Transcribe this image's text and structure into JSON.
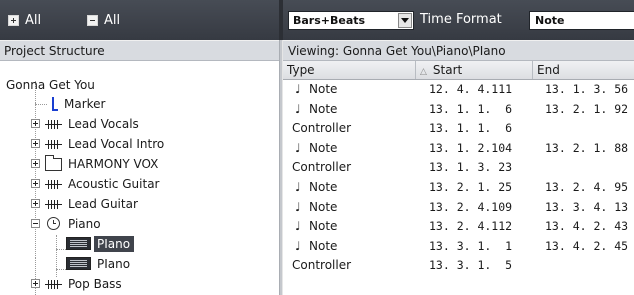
{
  "toolbar": {
    "expand_all_label": "All",
    "collapse_all_label": "All",
    "display_format": "Bars+Beats",
    "time_format_label": "Time Format",
    "event_type": "Note"
  },
  "project_structure": {
    "header": "Project Structure",
    "root": "Gonna Get You",
    "items": [
      {
        "label": "Marker",
        "icon": "marker-icon"
      },
      {
        "label": "Lead Vocals",
        "icon": "audio-track-icon"
      },
      {
        "label": "Lead Vocal Intro",
        "icon": "audio-track-icon"
      },
      {
        "label": "HARMONY VOX",
        "icon": "folder-icon"
      },
      {
        "label": "Acoustic Guitar",
        "icon": "audio-track-icon"
      },
      {
        "label": "Lead Guitar",
        "icon": "audio-track-icon"
      },
      {
        "label": "Piano",
        "icon": "midi-track-icon"
      },
      {
        "label": "PIano",
        "icon": "midi-part-icon"
      },
      {
        "label": "PIano",
        "icon": "midi-part-icon"
      },
      {
        "label": "Pop Bass",
        "icon": "audio-track-icon"
      }
    ]
  },
  "event_list": {
    "viewing_label": "Viewing: Gonna Get You\\Piano\\PIano",
    "columns": {
      "type": "Type",
      "start": "Start",
      "end": "End"
    },
    "rows": [
      {
        "type": "Note",
        "start": "12. 4. 4.111",
        "end": "13. 1. 3. 56"
      },
      {
        "type": "Note",
        "start": "13. 1. 1.  6",
        "end": "13. 2. 1. 92"
      },
      {
        "type": "Controller",
        "start": "13. 1. 1.  6",
        "end": ""
      },
      {
        "type": "Note",
        "start": "13. 1. 2.104",
        "end": "13. 2. 1. 88"
      },
      {
        "type": "Controller",
        "start": "13. 1. 3. 23",
        "end": ""
      },
      {
        "type": "Note",
        "start": "13. 2. 1. 25",
        "end": "13. 2. 4. 95"
      },
      {
        "type": "Note",
        "start": "13. 2. 4.109",
        "end": "13. 3. 4. 13"
      },
      {
        "type": "Note",
        "start": "13. 2. 4.112",
        "end": "13. 4. 2. 43"
      },
      {
        "type": "Note",
        "start": "13. 3. 1.  1",
        "end": "13. 4. 2. 45"
      },
      {
        "type": "Controller",
        "start": "13. 3. 1.  5",
        "end": ""
      }
    ]
  }
}
